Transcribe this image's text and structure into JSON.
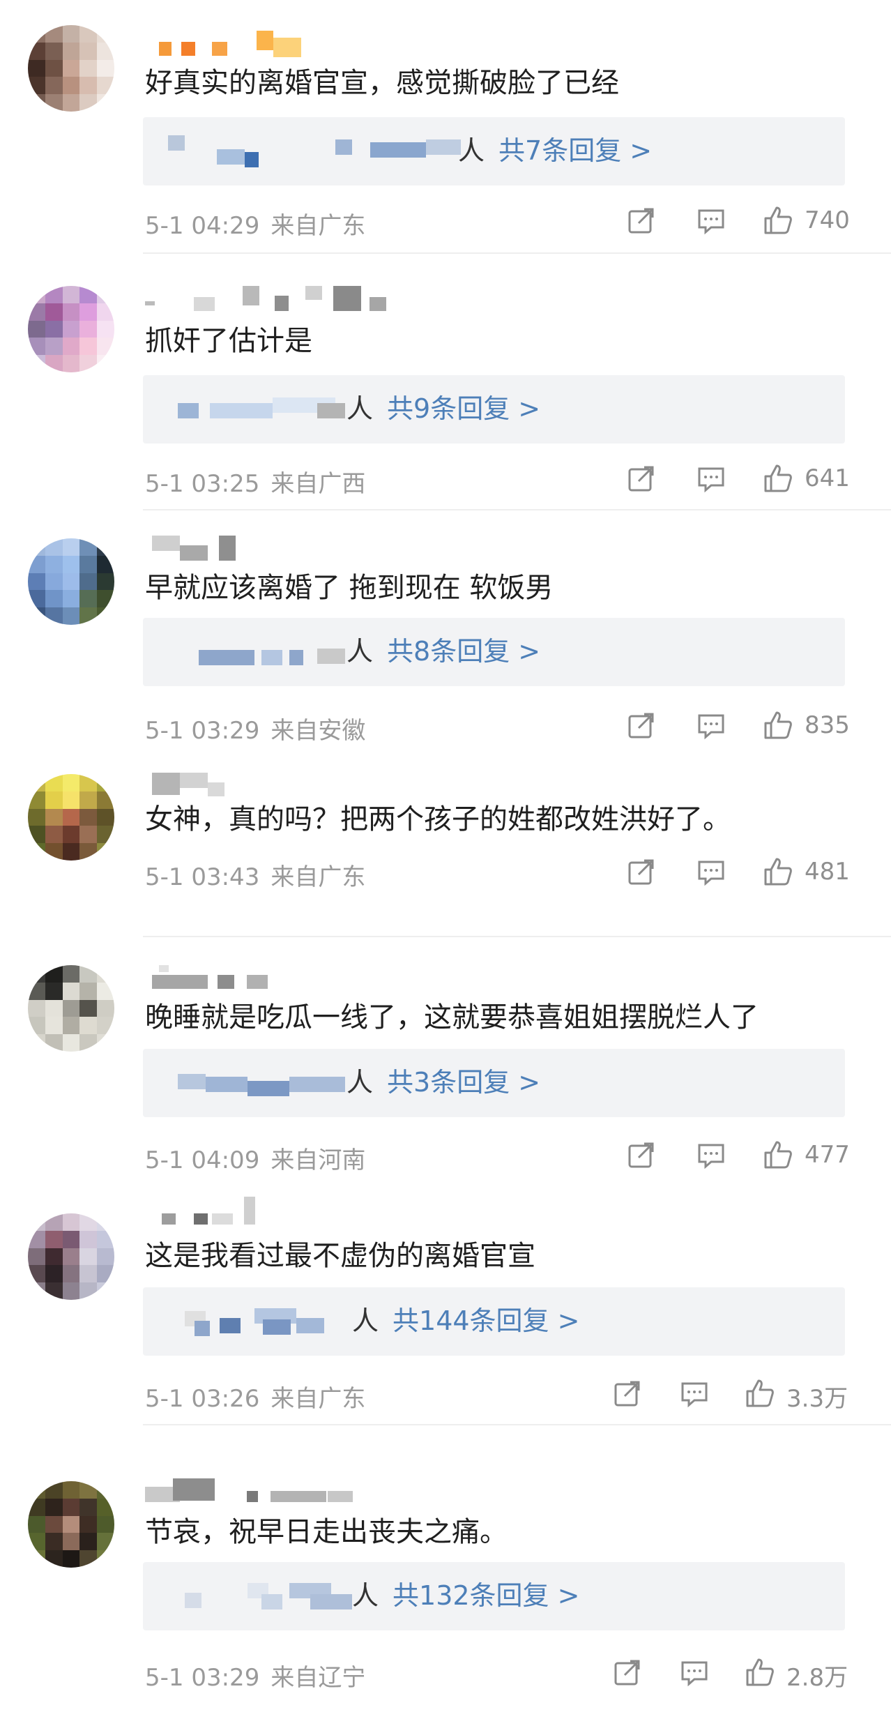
{
  "comments": [
    {
      "text": "好真实的离婚官宣，感觉撕破脸了已经",
      "reply_prefix": "人",
      "reply_count": "共7条回复 >",
      "date": "5-1 04:29",
      "location": "来自广东",
      "likes": "740"
    },
    {
      "text": "抓奸了估计是",
      "reply_prefix": "人",
      "reply_count": "共9条回复 >",
      "date": "5-1 03:25",
      "location": "来自广西",
      "likes": "641"
    },
    {
      "text": "早就应该离婚了  拖到现在  软饭男",
      "reply_prefix": "人",
      "reply_count": "共8条回复 >",
      "date": "5-1 03:29",
      "location": "来自安徽",
      "likes": "835"
    },
    {
      "text": "女神，真的吗？把两个孩子的姓都改姓洪好了。",
      "date": "5-1 03:43",
      "location": "来自广东",
      "likes": "481"
    },
    {
      "text": "晚睡就是吃瓜一线了，这就要恭喜姐姐摆脱烂人了",
      "reply_prefix": "人",
      "reply_count": "共3条回复 >",
      "date": "5-1 04:09",
      "location": "来自河南",
      "likes": "477"
    },
    {
      "text": "这是我看过最不虚伪的离婚官宣",
      "reply_prefix": "人",
      "reply_count": "共144条回复 >",
      "date": "5-1 03:26",
      "location": "来自广东",
      "likes": "3.3万"
    },
    {
      "text": "节哀，祝早日走出丧夫之痛。",
      "reply_prefix": "人",
      "reply_count": "共132条回复 >",
      "date": "5-1 03:29",
      "location": "来自辽宁",
      "likes": "2.8万"
    }
  ],
  "icons": {
    "share": "share-icon",
    "comment": "comment-icon",
    "like": "thumbs-up-icon"
  },
  "colors": {
    "reply_link": "#4d7fb8",
    "meta_text": "#9a9a9a",
    "reply_bg": "#f2f3f5"
  }
}
